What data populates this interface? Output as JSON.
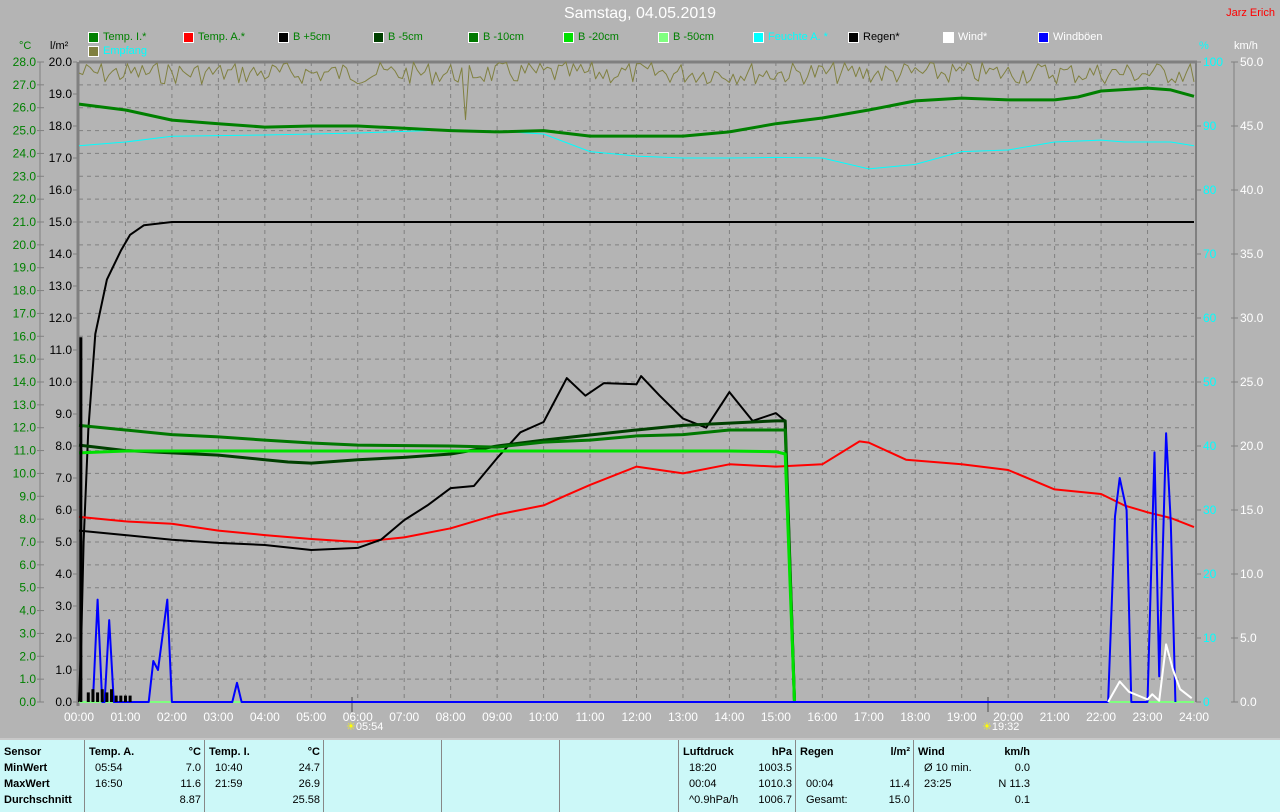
{
  "title": "Samstag, 04.05.2019",
  "author": "Jarz Erich",
  "legend": [
    {
      "label": "Temp. I.*",
      "color": "#008000",
      "text": "#008000"
    },
    {
      "label": "Temp. A.*",
      "color": "#ff0000",
      "text": "#008000"
    },
    {
      "label": "B +5cm",
      "color": "#000000",
      "text": "#008000"
    },
    {
      "label": "B -5cm",
      "color": "#004000",
      "text": "#008000"
    },
    {
      "label": "B -10cm",
      "color": "#007800",
      "text": "#008000"
    },
    {
      "label": "B -20cm",
      "color": "#00e000",
      "text": "#008000"
    },
    {
      "label": "B -50cm",
      "color": "#80ff80",
      "text": "#008000"
    },
    {
      "label": "Feuchte A. *",
      "color": "#00ffff",
      "text": "#00ffff"
    },
    {
      "label": "Regen*",
      "color": "#000000",
      "text": "#000000"
    },
    {
      "label": "Wind*",
      "color": "#ffffff",
      "text": "#ffffff"
    },
    {
      "label": "Windböen",
      "color": "#0000ff",
      "text": "#ffffff"
    },
    {
      "label": "Empfang",
      "color": "#808040",
      "text": "#00ffff"
    }
  ],
  "units": {
    "temp": "°C",
    "rain": "l/m²",
    "hum": "%",
    "wind": "km/h"
  },
  "sun": {
    "rise": "05:54",
    "set": "19:32"
  },
  "chart_data": {
    "type": "line",
    "title": "Samstag, 04.05.2019",
    "x_ticks": [
      "00:00",
      "01:00",
      "02:00",
      "03:00",
      "04:00",
      "05:00",
      "06:00",
      "07:00",
      "08:00",
      "09:00",
      "10:00",
      "11:00",
      "12:00",
      "13:00",
      "14:00",
      "15:00",
      "16:00",
      "17:00",
      "18:00",
      "19:00",
      "20:00",
      "21:00",
      "22:00",
      "23:00",
      "24:00"
    ],
    "xlim": [
      0,
      24
    ],
    "axes": {
      "temp": {
        "ylim": [
          0,
          28
        ],
        "ticks": [
          "0.0",
          "1.0",
          "2.0",
          "3.0",
          "4.0",
          "5.0",
          "6.0",
          "7.0",
          "8.0",
          "9.0",
          "10.0",
          "11.0",
          "12.0",
          "13.0",
          "14.0",
          "15.0",
          "16.0",
          "17.0",
          "18.0",
          "19.0",
          "20.0",
          "21.0",
          "22.0",
          "23.0",
          "24.0",
          "25.0",
          "26.0",
          "27.0",
          "28.0"
        ]
      },
      "rain": {
        "ylim": [
          0,
          20
        ],
        "ticks": [
          "0.0",
          "1.0",
          "2.0",
          "3.0",
          "4.0",
          "5.0",
          "6.0",
          "7.0",
          "8.0",
          "9.0",
          "10.0",
          "11.0",
          "12.0",
          "13.0",
          "14.0",
          "15.0",
          "16.0",
          "17.0",
          "18.0",
          "19.0",
          "20.0"
        ]
      },
      "hum": {
        "ylim": [
          0,
          100
        ],
        "ticks": [
          "0",
          "10",
          "20",
          "30",
          "40",
          "50",
          "60",
          "70",
          "80",
          "90",
          "100"
        ]
      },
      "wind": {
        "ylim": [
          0,
          50
        ],
        "ticks": [
          "0.0",
          "5.0",
          "10.0",
          "15.0",
          "20.0",
          "25.0",
          "30.0",
          "35.0",
          "40.0",
          "45.0",
          "50.0"
        ]
      }
    },
    "series": [
      {
        "name": "Empfang",
        "axis": "hum",
        "color": "#808040",
        "width": 1,
        "points": "noise"
      },
      {
        "name": "Feuchte A. *",
        "axis": "hum",
        "color": "#00ffff",
        "width": 1,
        "points": [
          [
            0,
            86.9
          ],
          [
            0.5,
            87.2
          ],
          [
            1,
            87.5
          ],
          [
            2,
            88.4
          ],
          [
            4,
            88.6
          ],
          [
            6,
            88.9
          ],
          [
            8,
            89.4
          ],
          [
            9,
            89.2
          ],
          [
            10,
            88.75
          ],
          [
            11,
            86
          ],
          [
            12,
            85.3
          ],
          [
            13,
            85
          ],
          [
            14,
            85
          ],
          [
            15,
            85.1
          ],
          [
            16,
            85
          ],
          [
            17,
            83.3
          ],
          [
            18,
            84
          ],
          [
            19,
            86
          ],
          [
            20,
            86.25
          ],
          [
            21,
            87.5
          ],
          [
            22,
            87.8
          ],
          [
            22.5,
            87.5
          ],
          [
            23.5,
            87.5
          ],
          [
            24,
            86.9
          ]
        ]
      },
      {
        "name": "Temp. I.*",
        "axis": "temp",
        "color": "#008000",
        "width": 3,
        "points": [
          [
            0,
            26.16
          ],
          [
            1,
            25.9
          ],
          [
            2,
            25.46
          ],
          [
            3,
            25.3
          ],
          [
            4,
            25.15
          ],
          [
            5,
            25.2
          ],
          [
            6,
            25.2
          ],
          [
            7,
            25.1
          ],
          [
            8,
            25
          ],
          [
            9,
            24.94
          ],
          [
            10,
            25
          ],
          [
            11,
            24.76
          ],
          [
            12,
            24.76
          ],
          [
            13,
            24.76
          ],
          [
            14,
            24.94
          ],
          [
            15,
            25.3
          ],
          [
            16,
            25.55
          ],
          [
            17,
            25.9
          ],
          [
            18,
            26.3
          ],
          [
            19,
            26.42
          ],
          [
            20,
            26.34
          ],
          [
            21,
            26.34
          ],
          [
            21.5,
            26.47
          ],
          [
            22,
            26.73
          ],
          [
            23,
            26.86
          ],
          [
            23.5,
            26.78
          ],
          [
            24,
            26.5
          ]
        ]
      },
      {
        "name": "Regen*",
        "axis": "rain",
        "color": "#000000",
        "width": 2,
        "points": [
          [
            0,
            0
          ],
          [
            0.05,
            2
          ],
          [
            0.1,
            5
          ],
          [
            0.2,
            8.5
          ],
          [
            0.35,
            11.5
          ],
          [
            0.6,
            13.2
          ],
          [
            0.9,
            14.1
          ],
          [
            1.1,
            14.6
          ],
          [
            1.4,
            14.9
          ],
          [
            2,
            15
          ],
          [
            24,
            15
          ]
        ]
      },
      {
        "name": "B -50cm",
        "axis": "temp",
        "color": "#80ff80",
        "width": 2,
        "points": [
          [
            0,
            0
          ],
          [
            24,
            0
          ]
        ]
      },
      {
        "name": "Temp. A.*",
        "axis": "temp",
        "color": "#ff0000",
        "width": 2,
        "points": [
          [
            0,
            8.1
          ],
          [
            1,
            7.9
          ],
          [
            2,
            7.8
          ],
          [
            3,
            7.5
          ],
          [
            4,
            7.3
          ],
          [
            5,
            7.13
          ],
          [
            6,
            7
          ],
          [
            7,
            7.2
          ],
          [
            8,
            7.6
          ],
          [
            9,
            8.2
          ],
          [
            10,
            8.6
          ],
          [
            10.5,
            9.05
          ],
          [
            11,
            9.5
          ],
          [
            12,
            10.3
          ],
          [
            13,
            10
          ],
          [
            14,
            10.4
          ],
          [
            15,
            10.3
          ],
          [
            16,
            10.4
          ],
          [
            16.8,
            11.4
          ],
          [
            17,
            11.35
          ],
          [
            17.8,
            10.6
          ],
          [
            19,
            10.4
          ],
          [
            20,
            10.15
          ],
          [
            21,
            9.3
          ],
          [
            22,
            9.1
          ],
          [
            22.5,
            8.6
          ],
          [
            23,
            8.3
          ],
          [
            23.5,
            8.05
          ],
          [
            24,
            7.65
          ]
        ]
      },
      {
        "name": "B +5cm",
        "axis": "temp",
        "color": "#000000",
        "width": 2,
        "points": [
          [
            0,
            7.5
          ],
          [
            1,
            7.3
          ],
          [
            2,
            7.1
          ],
          [
            3,
            6.96
          ],
          [
            4,
            6.87
          ],
          [
            5,
            6.65
          ],
          [
            6,
            6.74
          ],
          [
            6.5,
            7.1
          ],
          [
            7,
            7.96
          ],
          [
            7.5,
            8.6
          ],
          [
            8,
            9.36
          ],
          [
            8.5,
            9.45
          ],
          [
            9,
            10.67
          ],
          [
            9.5,
            11.8
          ],
          [
            10,
            12.25
          ],
          [
            10.5,
            14.17
          ],
          [
            10.9,
            13.4
          ],
          [
            11.3,
            13.95
          ],
          [
            12,
            13.9
          ],
          [
            12.1,
            14.26
          ],
          [
            12.5,
            13.4
          ],
          [
            13,
            12.4
          ],
          [
            13.5,
            12
          ],
          [
            14,
            13.56
          ],
          [
            14.5,
            12.3
          ],
          [
            15,
            12.64
          ],
          [
            15.2,
            12.3
          ],
          [
            15.4,
            0
          ]
        ]
      },
      {
        "name": "B -5cm",
        "axis": "temp",
        "color": "#004000",
        "width": 3,
        "points": [
          [
            0,
            11.24
          ],
          [
            1,
            11
          ],
          [
            2,
            10.9
          ],
          [
            3,
            10.8
          ],
          [
            4,
            10.6
          ],
          [
            4.5,
            10.5
          ],
          [
            5,
            10.45
          ],
          [
            6,
            10.6
          ],
          [
            7,
            10.7
          ],
          [
            8,
            10.85
          ],
          [
            9,
            11.2
          ],
          [
            10,
            11.46
          ],
          [
            11,
            11.68
          ],
          [
            12,
            11.9
          ],
          [
            13,
            12.1
          ],
          [
            14,
            12.2
          ],
          [
            15,
            12.3
          ],
          [
            15.2,
            12.3
          ],
          [
            15.4,
            0
          ]
        ]
      },
      {
        "name": "B -10cm",
        "axis": "temp",
        "color": "#007800",
        "width": 3,
        "points": [
          [
            0,
            12.1
          ],
          [
            1,
            11.9
          ],
          [
            2,
            11.7
          ],
          [
            3,
            11.6
          ],
          [
            4,
            11.46
          ],
          [
            5,
            11.33
          ],
          [
            6,
            11.24
          ],
          [
            8,
            11.2
          ],
          [
            9,
            11.15
          ],
          [
            10,
            11.37
          ],
          [
            11,
            11.46
          ],
          [
            12,
            11.64
          ],
          [
            13,
            11.7
          ],
          [
            14,
            11.9
          ],
          [
            15.2,
            11.9
          ],
          [
            15.4,
            0
          ]
        ]
      },
      {
        "name": "B -20cm",
        "axis": "temp",
        "color": "#00e000",
        "width": 3,
        "points": [
          [
            0,
            10.9
          ],
          [
            1,
            10.98
          ],
          [
            14,
            10.98
          ],
          [
            15,
            10.95
          ],
          [
            15.2,
            10.85
          ],
          [
            15.4,
            0
          ]
        ]
      },
      {
        "name": "Windböen",
        "axis": "wind",
        "color": "#0000ff",
        "width": 2,
        "points": [
          [
            0.3,
            0
          ],
          [
            0.4,
            8
          ],
          [
            0.5,
            0
          ],
          [
            0.55,
            0
          ],
          [
            0.65,
            6.4
          ],
          [
            0.75,
            0
          ],
          [
            1.5,
            0
          ],
          [
            1.6,
            3.2
          ],
          [
            1.7,
            2.5
          ],
          [
            1.9,
            8
          ],
          [
            2,
            0
          ],
          [
            3.3,
            0
          ],
          [
            3.4,
            1.5
          ],
          [
            3.5,
            0
          ],
          [
            22.15,
            0
          ],
          [
            22.3,
            14.5
          ],
          [
            22.4,
            17.5
          ],
          [
            22.55,
            15
          ],
          [
            22.65,
            0
          ],
          [
            23,
            0
          ],
          [
            23.15,
            19.5
          ],
          [
            23.25,
            2
          ],
          [
            23.4,
            21
          ],
          [
            23.5,
            14
          ],
          [
            23.6,
            0
          ]
        ]
      },
      {
        "name": "Wind*",
        "axis": "wind",
        "color": "#ffffff",
        "width": 2,
        "points": [
          [
            22.15,
            0
          ],
          [
            22.4,
            1.6
          ],
          [
            22.6,
            0.8
          ],
          [
            23,
            0.2
          ],
          [
            23.1,
            0.6
          ],
          [
            23.25,
            0.1
          ],
          [
            23.4,
            4.5
          ],
          [
            23.55,
            2.5
          ],
          [
            23.7,
            1
          ],
          [
            23.95,
            0.3
          ]
        ]
      },
      {
        "name": "Regenrate",
        "axis": "rain",
        "color": "#000000",
        "width": 3,
        "bars": [
          [
            0.04,
            11.4
          ],
          [
            0.2,
            0.3
          ],
          [
            0.3,
            0.4
          ],
          [
            0.4,
            0.3
          ],
          [
            0.5,
            0.4
          ],
          [
            0.6,
            0.3
          ],
          [
            0.7,
            0.4
          ],
          [
            0.8,
            0.2
          ],
          [
            0.9,
            0.2
          ],
          [
            1.0,
            0.2
          ],
          [
            1.1,
            0.2
          ]
        ]
      }
    ]
  },
  "stats": {
    "sensor": {
      "h": "Sensor",
      "r": [
        "MinWert",
        "MaxWert",
        "Durchschnitt"
      ]
    },
    "tempA": {
      "h": "Temp. A.",
      "u": "°C",
      "r": [
        [
          "05:54",
          "7.0"
        ],
        [
          "16:50",
          "11.6"
        ],
        [
          "",
          "8.87"
        ]
      ]
    },
    "tempI": {
      "h": "Temp. I.",
      "u": "°C",
      "r": [
        [
          "10:40",
          "24.7"
        ],
        [
          "21:59",
          "26.9"
        ],
        [
          "",
          "25.58"
        ]
      ]
    },
    "druck": {
      "h": "Luftdruck",
      "u": "hPa",
      "r": [
        [
          "18:20",
          "1003.5"
        ],
        [
          "00:04",
          "1010.3"
        ],
        [
          "^0.9hPa/h",
          "1006.7"
        ]
      ]
    },
    "regen": {
      "h": "Regen",
      "u": "l/m²",
      "r": [
        [
          "",
          ""
        ],
        [
          "00:04",
          "11.4"
        ],
        [
          "Gesamt:",
          "15.0"
        ]
      ]
    },
    "wind": {
      "h": "Wind",
      "u": "km/h",
      "r": [
        [
          "Ø 10 min.",
          "0.0"
        ],
        [
          "23:25",
          "N 11.3"
        ],
        [
          "",
          "0.1"
        ]
      ]
    }
  }
}
